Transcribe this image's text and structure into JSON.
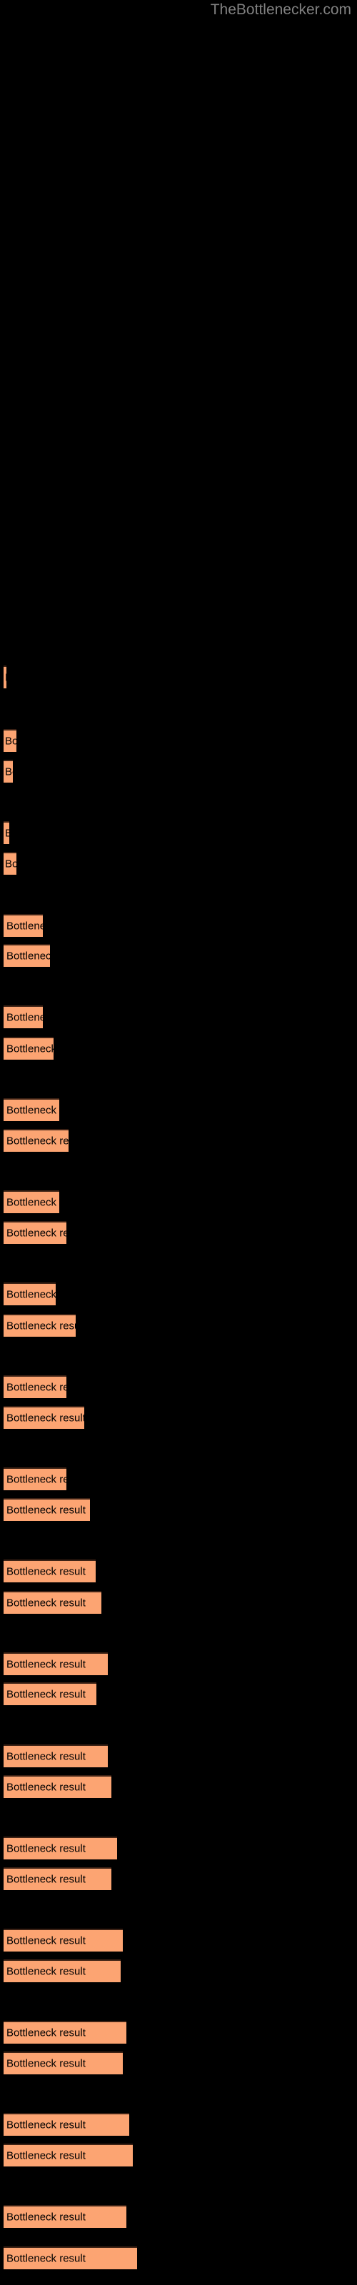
{
  "header": {
    "site_title": "TheBottlenecker.com"
  },
  "theme": {
    "background": "#000000",
    "bar_fill": "#fca472",
    "bar_border_top": "#3d2215",
    "bar_label_color": "#000000",
    "title_color": "#808080"
  },
  "chart_data": {
    "type": "bar",
    "orientation": "horizontal",
    "title": "TheBottlenecker.com",
    "xlabel": "",
    "ylabel": "",
    "grid": false,
    "legend": null,
    "bar_label_text": "Bottleneck result",
    "categories": [
      "Bottleneck result",
      "Bottleneck result",
      "Bottleneck result",
      "Bottleneck result",
      "Bottleneck result",
      "Bottleneck result",
      "Bottleneck result",
      "Bottleneck result",
      "Bottleneck result",
      "Bottleneck result",
      "Bottleneck result",
      "Bottleneck result",
      "Bottleneck result",
      "Bottleneck result",
      "Bottleneck result",
      "Bottleneck result",
      "Bottleneck result",
      "Bottleneck result",
      "Bottleneck result",
      "Bottleneck result",
      "Bottleneck result",
      "Bottleneck result",
      "Bottleneck result",
      "Bottleneck result",
      "Bottleneck result",
      "Bottleneck result",
      "Bottleneck result"
    ],
    "values": [
      4,
      18,
      13,
      18,
      42,
      54,
      42,
      62,
      79,
      62,
      72,
      54,
      85,
      66,
      96,
      109,
      91,
      117,
      96,
      117,
      100,
      130,
      117,
      130,
      122,
      143,
      135
    ],
    "xlim": [
      0,
      200
    ],
    "bars": [
      {
        "index": 0,
        "y": 932,
        "width": 4,
        "label": "Bottleneck result"
      },
      {
        "index": 1,
        "y": 1021,
        "width": 18,
        "label": "Bottleneck result"
      },
      {
        "index": 2,
        "y": 1064,
        "width": 13,
        "label": "Bottleneck result"
      },
      {
        "index": 3,
        "y": 1150,
        "width": 8,
        "label": "Bottleneck result"
      },
      {
        "index": 4,
        "y": 1193,
        "width": 18,
        "label": "Bottleneck result"
      },
      {
        "index": 5,
        "y": 1280,
        "width": 55,
        "label": "Bottleneck result"
      },
      {
        "index": 6,
        "y": 1322,
        "width": 65,
        "label": "Bottleneck result"
      },
      {
        "index": 7,
        "y": 1408,
        "width": 55,
        "label": "Bottleneck result"
      },
      {
        "index": 8,
        "y": 1452,
        "width": 70,
        "label": "Bottleneck result"
      },
      {
        "index": 9,
        "y": 1538,
        "width": 78,
        "label": "Bottleneck result"
      },
      {
        "index": 10,
        "y": 1581,
        "width": 91,
        "label": "Bottleneck result"
      },
      {
        "index": 11,
        "y": 1667,
        "width": 78,
        "label": "Bottleneck result"
      },
      {
        "index": 12,
        "y": 1710,
        "width": 88,
        "label": "Bottleneck result"
      },
      {
        "index": 13,
        "y": 1796,
        "width": 73,
        "label": "Bottleneck result"
      },
      {
        "index": 14,
        "y": 1840,
        "width": 101,
        "label": "Bottleneck result"
      },
      {
        "index": 15,
        "y": 1926,
        "width": 88,
        "label": "Bottleneck result"
      },
      {
        "index": 16,
        "y": 1969,
        "width": 113,
        "label": "Bottleneck result"
      },
      {
        "index": 17,
        "y": 2055,
        "width": 88,
        "label": "Bottleneck result"
      },
      {
        "index": 18,
        "y": 2098,
        "width": 121,
        "label": "Bottleneck result"
      },
      {
        "index": 19,
        "y": 2184,
        "width": 129,
        "label": "Bottleneck result"
      },
      {
        "index": 20,
        "y": 2228,
        "width": 137,
        "label": "Bottleneck result"
      },
      {
        "index": 21,
        "y": 2314,
        "width": 146,
        "label": "Bottleneck result"
      },
      {
        "index": 22,
        "y": 2356,
        "width": 130,
        "label": "Bottleneck result"
      },
      {
        "index": 23,
        "y": 2443,
        "width": 146,
        "label": "Bottleneck result"
      },
      {
        "index": 24,
        "y": 2486,
        "width": 151,
        "label": "Bottleneck result"
      },
      {
        "index": 25,
        "y": 2572,
        "width": 159,
        "label": "Bottleneck result"
      },
      {
        "index": 26,
        "y": 2615,
        "width": 151,
        "label": "Bottleneck result"
      },
      {
        "index": 27,
        "y": 2701,
        "width": 167,
        "label": "Bottleneck result"
      },
      {
        "index": 28,
        "y": 2744,
        "width": 164,
        "label": "Bottleneck result"
      },
      {
        "index": 29,
        "y": 2830,
        "width": 172,
        "label": "Bottleneck result"
      },
      {
        "index": 30,
        "y": 2873,
        "width": 167,
        "label": "Bottleneck result"
      },
      {
        "index": 31,
        "y": 2959,
        "width": 176,
        "label": "Bottleneck result"
      },
      {
        "index": 32,
        "y": 3002,
        "width": 181,
        "label": "Bottleneck result"
      },
      {
        "index": 33,
        "y": 3088,
        "width": 172,
        "label": "Bottleneck result"
      },
      {
        "index": 34,
        "y": 3146,
        "width": 187,
        "label": "Bottleneck result"
      }
    ]
  }
}
